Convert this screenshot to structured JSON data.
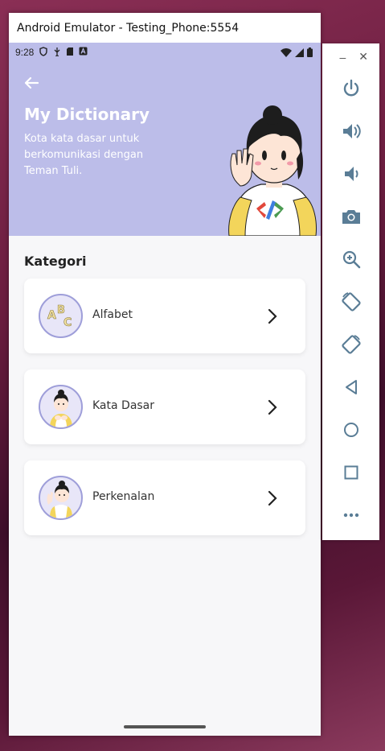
{
  "window": {
    "title": "Android Emulator - Testing_Phone:5554"
  },
  "status_bar": {
    "time": "9:28"
  },
  "header": {
    "title": "My Dictionary",
    "subtitle": "Kota kata dasar untuk berkomunikasi dengan Teman Tuli."
  },
  "section": {
    "title": "Kategori"
  },
  "categories": [
    {
      "label": "Alfabet",
      "icon": "abc-letters-icon"
    },
    {
      "label": "Kata Dasar",
      "icon": "girl-sign-icon"
    },
    {
      "label": "Perkenalan",
      "icon": "girl-wave-icon"
    }
  ],
  "side_panel": {
    "controls": [
      "minimize",
      "close",
      "power",
      "volume-up",
      "volume-down",
      "camera",
      "zoom",
      "rotate-left",
      "rotate-right",
      "back",
      "home",
      "overview",
      "more"
    ]
  },
  "colors": {
    "hero_bg": "#bcbde9",
    "accent_icon": "#5a7d96",
    "card_bg": "#ffffff"
  }
}
